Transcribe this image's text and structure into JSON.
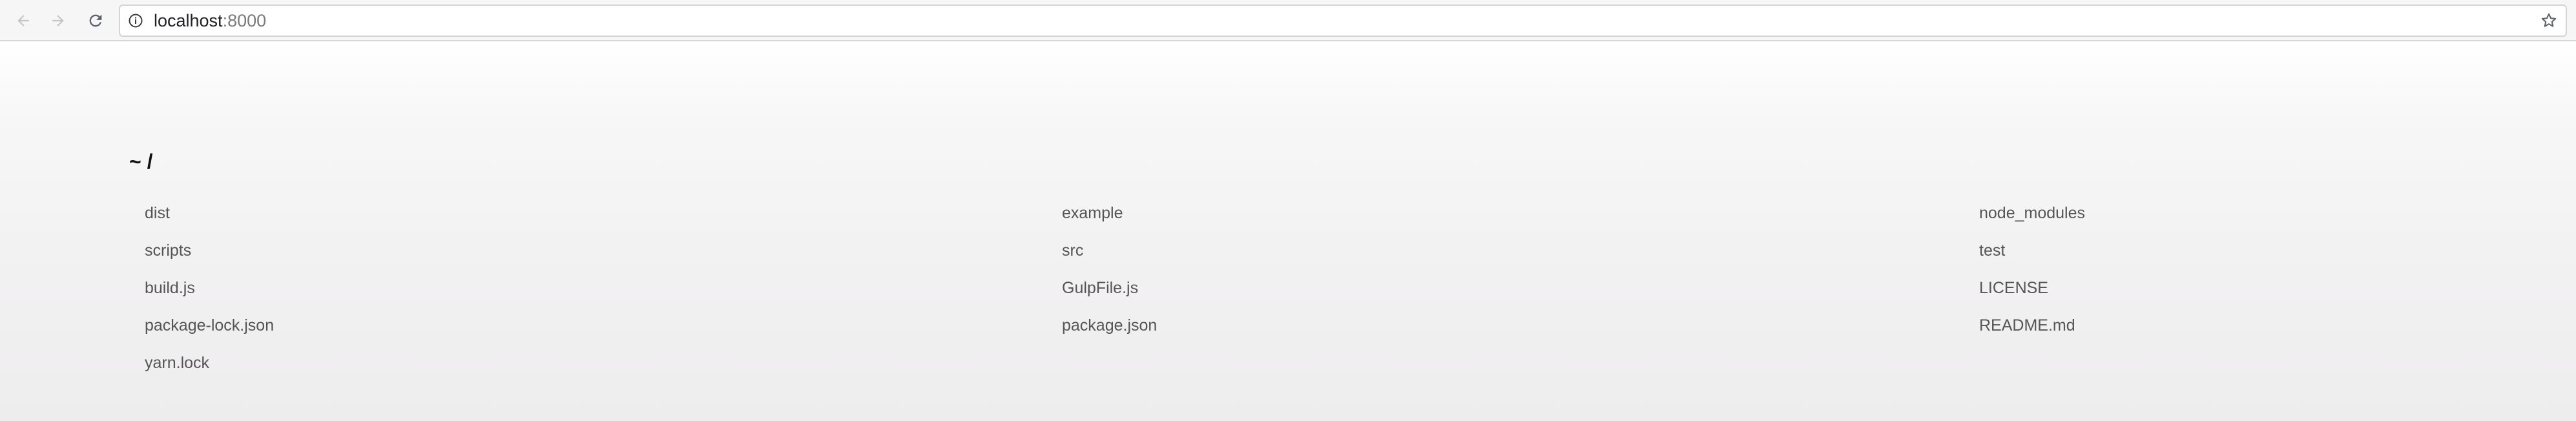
{
  "browser": {
    "url_host": "localhost",
    "url_port": ":8000",
    "icons": {
      "back": "arrow-left-icon",
      "forward": "arrow-right-icon",
      "reload": "reload-icon",
      "info": "info-icon",
      "bookmark": "star-icon"
    }
  },
  "page": {
    "title": "~ /",
    "files": [
      "dist",
      "example",
      "node_modules",
      "scripts",
      "src",
      "test",
      "build.js",
      "GulpFile.js",
      "LICENSE",
      "package-lock.json",
      "package.json",
      "README.md",
      "yarn.lock"
    ]
  },
  "colors": {
    "toolbar_bg": "#f6f6f6",
    "link": "#555555",
    "title": "#111111",
    "disabled_icon": "#c4c4c4",
    "active_icon": "#5f6368"
  }
}
